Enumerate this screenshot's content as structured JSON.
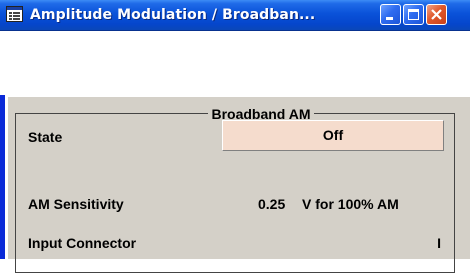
{
  "window": {
    "title": "Amplitude Modulation / Broadban...",
    "icon": "app-window-icon",
    "controls": [
      "minimize-icon",
      "maximize-icon",
      "close-icon"
    ]
  },
  "group": {
    "title": "Broadband AM"
  },
  "rows": {
    "state": {
      "label": "State",
      "value": "Off"
    },
    "sensitivity": {
      "label": "AM Sensitivity",
      "value": "0.25",
      "unit": "V for 100% AM"
    },
    "connector": {
      "label": "Input Connector",
      "value": "I"
    }
  },
  "colors": {
    "titlebar": "#0a52d9",
    "panel": "#d4d0c8",
    "state_button": "#f5dccd",
    "close_button": "#e0582c"
  }
}
